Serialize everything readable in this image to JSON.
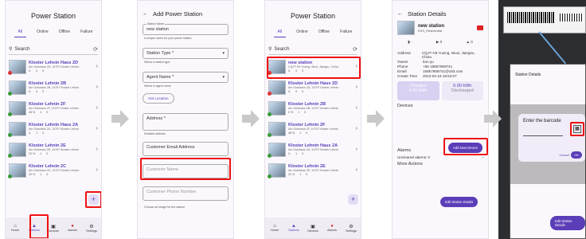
{
  "list_screen": {
    "title": "Power Station",
    "tabs": [
      "All",
      "Online",
      "Offline",
      "Failure"
    ],
    "search_placeholder": "Search",
    "stations": [
      {
        "name": "Kloster Lehnin Haus 2D",
        "addr": "Am Gutshaus 2D, 14797 Kloster Lehnin",
        "a": "0-",
        "b": "0",
        "c": "0",
        "status": "red"
      },
      {
        "name": "Kloster Lehnin 2B",
        "addr": "Am Gutshaus 2B, 14797 Kloster Lehnin",
        "a": "0-",
        "b": "0",
        "c": "0",
        "status": "green"
      },
      {
        "name": "Kloster Lehnin 2F",
        "addr": "Am Gutshaus 2F, 14797 Kloster Lehnin",
        "a": "45 %",
        "b": "1",
        "c": "0",
        "status": "green"
      },
      {
        "name": "Kloster Lehnin Haus 2A",
        "addr": "Am Gutshaus 2A, 14797 Kloster Lehnin",
        "a": "0-",
        "b": "1",
        "c": "0",
        "status": "green"
      },
      {
        "name": "Kloster Lehnin 2E",
        "addr": "Am Gutshaus 2E, 14797 Kloster Lehnin",
        "a": "22 %",
        "b": "1",
        "c": "0",
        "status": "green"
      },
      {
        "name": "Kloster Lehnin 2C",
        "addr": "Am Gutshaus 2C, 14797 Kloster Lehnin",
        "a": "22 %",
        "b": "1",
        "c": "0",
        "status": "green"
      }
    ],
    "nav": [
      "Home",
      "Stations",
      "Devices",
      "Alarms",
      "Settings"
    ]
  },
  "add_screen": {
    "title": "Add Power Station",
    "station_name_label": "Station Name",
    "station_name_value": "new station",
    "station_name_help": "A unique name for your power station",
    "station_type": "Station Type *",
    "station_type_help": "Select a station type",
    "agent_name": "Agent Name *",
    "agent_help": "Select in agent name",
    "get_location": "Get Location",
    "address": "Address *",
    "address_help": "Detailed address",
    "customer_email": "Customer Email Address",
    "customer_name": "Customer Name",
    "customer_phone": "Customer Phone Number",
    "image_help": "Choose an image for the station"
  },
  "list2_screen": {
    "title": "Power Station",
    "stations": [
      {
        "name": "new station",
        "addr": "CQ,P+V5 Yuxing, Wuxi, Jiangsu, China",
        "a": "0-",
        "b": "0",
        "c": "0",
        "status": "red"
      },
      {
        "name": "Kloster Lehnin Haus 2D",
        "addr": "Am Gutshaus 2D, 14797 Kloster Lehnin",
        "a": "0-",
        "b": "0",
        "c": "0",
        "status": "red"
      },
      {
        "name": "Kloster Lehnin 2B",
        "addr": "Am Gutshaus 2B, 14797 Kloster Lehnin",
        "a": "0 %",
        "b": "1",
        "c": "0",
        "status": "green"
      },
      {
        "name": "Kloster Lehnin 2F",
        "addr": "Am Gutshaus 2F, 14797 Kloster Lehnin",
        "a": "46 %",
        "b": "1",
        "c": "0",
        "status": "green"
      },
      {
        "name": "Kloster Lehnin Haus 2A",
        "addr": "Am Gutshaus 2A, 14797 Kloster Lehnin",
        "a": "0-",
        "b": "1",
        "c": "0",
        "status": "green"
      },
      {
        "name": "Kloster Lehnin 2E",
        "addr": "Am Gutshaus 2E, 14797 Kloster Lehnin",
        "a": "22 %",
        "b": "1",
        "c": "0",
        "status": "green"
      }
    ]
  },
  "details_screen": {
    "title": "Station Details",
    "name": "new station",
    "type": "ESS_Residential",
    "address_k": "Address",
    "address_v": "CQ,P+V5 Yuxing, Wuxi, Jiangsu, China",
    "owner_k": "Owner",
    "owner_v": "bon yu",
    "phone_k": "Phone",
    "phone_v": "+86 15857959741",
    "email_k": "Email",
    "email_v": "15857959741@163.com",
    "create_k": "Create Time",
    "create_v": "2024-04-16 15:52:07",
    "charged": "Charged",
    "charged_v": "0.00 kWh",
    "discharged": "Discharged",
    "discharged_v": "0.00 kWh",
    "devices": "Devices",
    "add_device": "Add New Device",
    "alarms": "Alarms",
    "uncleared": "Uncleared alarms: 0",
    "more_actions": "More Actions",
    "edit": "Edit Station Details"
  },
  "barcode_dialog": {
    "title": "Enter the barcode",
    "cancel": "Cancel",
    "ok": "OK"
  }
}
